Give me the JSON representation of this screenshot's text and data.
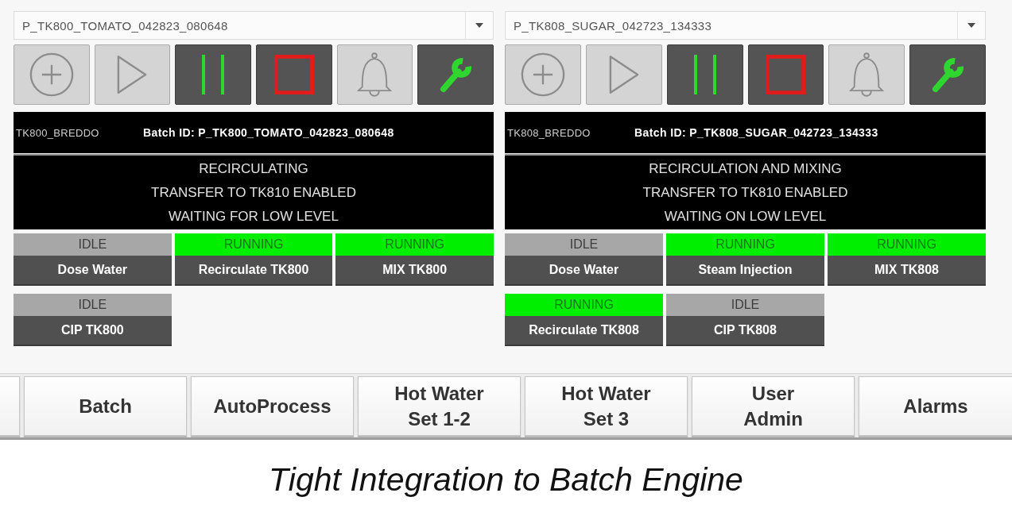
{
  "units": [
    {
      "batch_select": {
        "value": "P_TK800_TOMATO_042823_080648"
      },
      "controls": [
        {
          "kind": "add",
          "disabled": true
        },
        {
          "kind": "play",
          "disabled": true
        },
        {
          "kind": "pause",
          "disabled": false
        },
        {
          "kind": "stop",
          "disabled": false
        },
        {
          "kind": "alarm",
          "disabled": true
        },
        {
          "kind": "maintenance",
          "disabled": false
        }
      ],
      "unit_name": "TK800_BREDDO",
      "batch_id": "Batch ID: P_TK800_TOMATO_042823_080648",
      "messages": [
        "RECIRCULATING",
        "TRANSFER TO TK810 ENABLED",
        "WAITING FOR LOW LEVEL"
      ],
      "phases": [
        {
          "status": "IDLE",
          "running": false,
          "name": "Dose Water"
        },
        {
          "status": "RUNNING",
          "running": true,
          "name": "Recirculate TK800"
        },
        {
          "status": "RUNNING",
          "running": true,
          "name": "MIX TK800"
        },
        {
          "status": "IDLE",
          "running": false,
          "name": "CIP TK800"
        }
      ]
    },
    {
      "batch_select": {
        "value": "P_TK808_SUGAR_042723_134333"
      },
      "controls": [
        {
          "kind": "add",
          "disabled": true
        },
        {
          "kind": "play",
          "disabled": true
        },
        {
          "kind": "pause",
          "disabled": false
        },
        {
          "kind": "stop",
          "disabled": false
        },
        {
          "kind": "alarm",
          "disabled": true
        },
        {
          "kind": "maintenance",
          "disabled": false
        }
      ],
      "unit_name": "TK808_BREDDO",
      "batch_id": "Batch ID: P_TK808_SUGAR_042723_134333",
      "messages": [
        "RECIRCULATION AND MIXING",
        "TRANSFER TO TK810 ENABLED",
        "WAITING ON LOW LEVEL"
      ],
      "phases": [
        {
          "status": "IDLE",
          "running": false,
          "name": "Dose Water"
        },
        {
          "status": "RUNNING",
          "running": true,
          "name": "Steam Injection"
        },
        {
          "status": "RUNNING",
          "running": true,
          "name": "MIX TK808"
        },
        {
          "status": "RUNNING",
          "running": true,
          "name": "Recirculate TK808"
        },
        {
          "status": "IDLE",
          "running": false,
          "name": "CIP TK808"
        }
      ]
    }
  ],
  "nav": [
    {
      "label": "Batch"
    },
    {
      "label": "AutoProcess"
    },
    {
      "label": "Hot Water\nSet 1-2"
    },
    {
      "label": "Hot Water\nSet 3"
    },
    {
      "label": "User\nAdmin"
    },
    {
      "label": "Alarms"
    }
  ],
  "caption": "Tight Integration to Batch Engine"
}
